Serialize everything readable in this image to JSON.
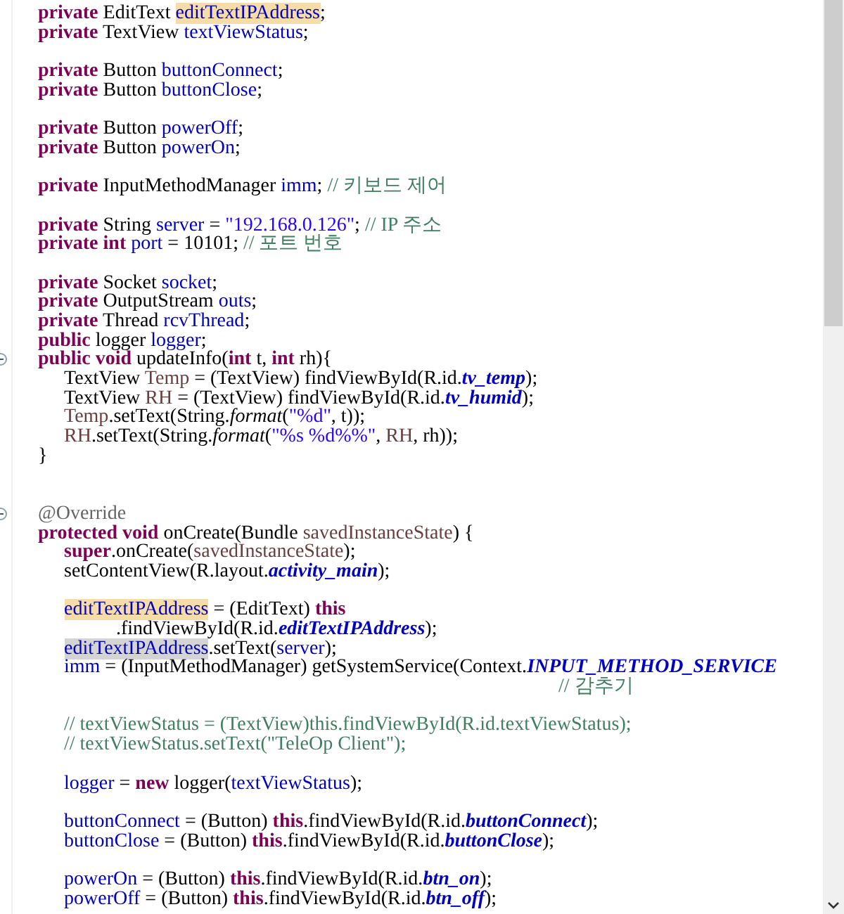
{
  "editor": {
    "lines": [
      {
        "kind": "code",
        "tokens": [
          {
            "text": "private",
            "kind": "keyword"
          },
          {
            "text": " EditText ",
            "kind": "plain"
          },
          {
            "text": "editTextIPAddress",
            "kind": "field",
            "occurrence": true
          },
          {
            "text": ";",
            "kind": "plain"
          }
        ]
      },
      {
        "kind": "code",
        "tokens": [
          {
            "text": "private",
            "kind": "keyword"
          },
          {
            "text": " TextView ",
            "kind": "plain"
          },
          {
            "text": "textViewStatus",
            "kind": "field"
          },
          {
            "text": ";",
            "kind": "plain"
          }
        ]
      },
      {
        "kind": "blank"
      },
      {
        "kind": "code",
        "tokens": [
          {
            "text": "private",
            "kind": "keyword"
          },
          {
            "text": " Button ",
            "kind": "plain"
          },
          {
            "text": "buttonConnect",
            "kind": "field"
          },
          {
            "text": ";",
            "kind": "plain"
          }
        ]
      },
      {
        "kind": "code",
        "tokens": [
          {
            "text": "private",
            "kind": "keyword"
          },
          {
            "text": " Button ",
            "kind": "plain"
          },
          {
            "text": "buttonClose",
            "kind": "field"
          },
          {
            "text": ";",
            "kind": "plain"
          }
        ]
      },
      {
        "kind": "blank"
      },
      {
        "kind": "code",
        "tokens": [
          {
            "text": "private",
            "kind": "keyword"
          },
          {
            "text": " Button ",
            "kind": "plain"
          },
          {
            "text": "powerOff",
            "kind": "field"
          },
          {
            "text": ";",
            "kind": "plain"
          }
        ]
      },
      {
        "kind": "code",
        "tokens": [
          {
            "text": "private",
            "kind": "keyword"
          },
          {
            "text": " Button ",
            "kind": "plain"
          },
          {
            "text": "powerOn",
            "kind": "field"
          },
          {
            "text": ";",
            "kind": "plain"
          }
        ]
      },
      {
        "kind": "blank"
      },
      {
        "kind": "code",
        "tokens": [
          {
            "text": "private",
            "kind": "keyword"
          },
          {
            "text": " InputMethodManager ",
            "kind": "plain"
          },
          {
            "text": "imm",
            "kind": "field"
          },
          {
            "text": "; ",
            "kind": "plain"
          },
          {
            "text": "// 키보드 제어",
            "kind": "comment"
          }
        ]
      },
      {
        "kind": "blank"
      },
      {
        "kind": "code",
        "tokens": [
          {
            "text": "private",
            "kind": "keyword"
          },
          {
            "text": " String ",
            "kind": "plain"
          },
          {
            "text": "server",
            "kind": "field"
          },
          {
            "text": " = ",
            "kind": "plain"
          },
          {
            "text": "\"192.168.0.126\"",
            "kind": "string"
          },
          {
            "text": "; ",
            "kind": "plain"
          },
          {
            "text": "// IP 주소",
            "kind": "comment"
          }
        ]
      },
      {
        "kind": "code",
        "tokens": [
          {
            "text": "private int ",
            "kind": "keyword"
          },
          {
            "text": "port",
            "kind": "field"
          },
          {
            "text": " = 10101; ",
            "kind": "plain"
          },
          {
            "text": "// 포트 번호",
            "kind": "comment"
          }
        ]
      },
      {
        "kind": "blank"
      },
      {
        "kind": "code",
        "tokens": [
          {
            "text": "private",
            "kind": "keyword"
          },
          {
            "text": " Socket ",
            "kind": "plain"
          },
          {
            "text": "socket",
            "kind": "field"
          },
          {
            "text": ";",
            "kind": "plain"
          }
        ]
      },
      {
        "kind": "code",
        "tokens": [
          {
            "text": "private",
            "kind": "keyword"
          },
          {
            "text": " OutputStream ",
            "kind": "plain"
          },
          {
            "text": "outs",
            "kind": "field"
          },
          {
            "text": ";",
            "kind": "plain"
          }
        ]
      },
      {
        "kind": "code",
        "tokens": [
          {
            "text": "private",
            "kind": "keyword"
          },
          {
            "text": " Thread ",
            "kind": "plain"
          },
          {
            "text": "rcvThread",
            "kind": "field"
          },
          {
            "text": ";",
            "kind": "plain"
          }
        ]
      },
      {
        "kind": "code",
        "tokens": [
          {
            "text": "public",
            "kind": "keyword"
          },
          {
            "text": " logger ",
            "kind": "plain"
          },
          {
            "text": "logger",
            "kind": "field"
          },
          {
            "text": ";",
            "kind": "plain"
          }
        ]
      },
      {
        "kind": "code",
        "expanded": true,
        "tokens": [
          {
            "text": "public void",
            "kind": "keyword"
          },
          {
            "text": " updateInfo(",
            "kind": "plain"
          },
          {
            "text": "int",
            "kind": "keyword"
          },
          {
            "text": " t, ",
            "kind": "plain"
          },
          {
            "text": "int",
            "kind": "keyword"
          },
          {
            "text": " rh){",
            "kind": "plain"
          }
        ]
      },
      {
        "kind": "code",
        "indented": true,
        "tokens": [
          {
            "text": "TextView ",
            "kind": "plain"
          },
          {
            "text": "Temp",
            "kind": "local"
          },
          {
            "text": " = (TextView) findViewById(R.id.",
            "kind": "plain"
          },
          {
            "text": "tv_temp",
            "kind": "constant"
          },
          {
            "text": ");",
            "kind": "plain"
          }
        ]
      },
      {
        "kind": "code",
        "indented": true,
        "tokens": [
          {
            "text": "TextView ",
            "kind": "plain"
          },
          {
            "text": "RH",
            "kind": "local"
          },
          {
            "text": " = (TextView) findViewById(R.id.",
            "kind": "plain"
          },
          {
            "text": "tv_humid",
            "kind": "constant"
          },
          {
            "text": ");",
            "kind": "plain"
          }
        ]
      },
      {
        "kind": "code",
        "indented": true,
        "tokens": [
          {
            "text": "Temp",
            "kind": "local"
          },
          {
            "text": ".setText(String.",
            "kind": "plain"
          },
          {
            "text": "format",
            "kind": "static"
          },
          {
            "text": "(",
            "kind": "plain"
          },
          {
            "text": "\"%d\"",
            "kind": "string"
          },
          {
            "text": ", t));",
            "kind": "plain"
          }
        ]
      },
      {
        "kind": "code",
        "indented": true,
        "tokens": [
          {
            "text": "RH",
            "kind": "local"
          },
          {
            "text": ".setText(String.",
            "kind": "plain"
          },
          {
            "text": "format",
            "kind": "static"
          },
          {
            "text": "(",
            "kind": "plain"
          },
          {
            "text": "\"%s %d%%\"",
            "kind": "string"
          },
          {
            "text": ", ",
            "kind": "plain"
          },
          {
            "text": "RH",
            "kind": "local"
          },
          {
            "text": ", rh));",
            "kind": "plain"
          }
        ]
      },
      {
        "kind": "code",
        "tokens": [
          {
            "text": "}",
            "kind": "plain"
          }
        ]
      },
      {
        "kind": "blank"
      },
      {
        "kind": "blank"
      },
      {
        "kind": "code",
        "expanded": true,
        "tokens": [
          {
            "text": "@Override",
            "kind": "annotation"
          }
        ]
      },
      {
        "kind": "code",
        "tokens": [
          {
            "text": "protected void",
            "kind": "keyword"
          },
          {
            "text": " onCreate(Bundle ",
            "kind": "plain"
          },
          {
            "text": "savedInstanceState",
            "kind": "local"
          },
          {
            "text": ") {",
            "kind": "plain"
          }
        ]
      },
      {
        "kind": "code",
        "indented": true,
        "tokens": [
          {
            "text": "super",
            "kind": "keyword"
          },
          {
            "text": ".onCreate(",
            "kind": "plain"
          },
          {
            "text": "savedInstanceState",
            "kind": "local"
          },
          {
            "text": ");",
            "kind": "plain"
          }
        ]
      },
      {
        "kind": "code",
        "indented": true,
        "tokens": [
          {
            "text": "setContentView(R.layout.",
            "kind": "plain"
          },
          {
            "text": "activity_main",
            "kind": "constant"
          },
          {
            "text": ");",
            "kind": "plain"
          }
        ]
      },
      {
        "kind": "blank"
      },
      {
        "kind": "code",
        "indented": true,
        "tokens": [
          {
            "text": "editTextIPAddress",
            "kind": "field",
            "occurrence": true
          },
          {
            "text": " = (EditText) ",
            "kind": "plain"
          },
          {
            "text": "this",
            "kind": "keyword"
          }
        ]
      },
      {
        "kind": "code",
        "tokens": [
          {
            "text": "\t\t\t.findViewById(R.id.",
            "kind": "plain"
          },
          {
            "text": "editTextIPAddress",
            "kind": "constant"
          },
          {
            "text": ");",
            "kind": "plain"
          }
        ]
      },
      {
        "kind": "code",
        "indented": true,
        "tokens": [
          {
            "text": "editTextIPAddress",
            "kind": "field",
            "selected": true
          },
          {
            "text": ".setText(",
            "kind": "plain"
          },
          {
            "text": "server",
            "kind": "field"
          },
          {
            "text": ");",
            "kind": "plain"
          }
        ]
      },
      {
        "kind": "code",
        "indented": true,
        "tokens": [
          {
            "text": "imm",
            "kind": "field"
          },
          {
            "text": " = (InputMethodManager) getSystemService(Context.",
            "kind": "plain"
          },
          {
            "text": "INPUT_METHOD_SERVICE",
            "kind": "constant"
          }
        ]
      },
      {
        "kind": "code",
        "tokens": [
          {
            "text": "\t\t\t\t\t\t\t\t\t\t\t\t\t\t\t\t\t\t\t\t// 감추기",
            "kind": "comment"
          }
        ]
      },
      {
        "kind": "blank"
      },
      {
        "kind": "code",
        "indented": true,
        "tokens": [
          {
            "text": "// textViewStatus = (TextView)this.findViewById(R.id.textViewStatus);",
            "kind": "comment"
          }
        ]
      },
      {
        "kind": "code",
        "indented": true,
        "tokens": [
          {
            "text": "// textViewStatus.setText(\"TeleOp Client\");",
            "kind": "comment"
          }
        ]
      },
      {
        "kind": "blank"
      },
      {
        "kind": "code",
        "indented": true,
        "tokens": [
          {
            "text": "logger",
            "kind": "field"
          },
          {
            "text": " = ",
            "kind": "plain"
          },
          {
            "text": "new",
            "kind": "keyword"
          },
          {
            "text": " logger(",
            "kind": "plain"
          },
          {
            "text": "textViewStatus",
            "kind": "field"
          },
          {
            "text": ");",
            "kind": "plain"
          }
        ]
      },
      {
        "kind": "blank"
      },
      {
        "kind": "code",
        "indented": true,
        "tokens": [
          {
            "text": "buttonConnect",
            "kind": "field"
          },
          {
            "text": " = (Button) ",
            "kind": "plain"
          },
          {
            "text": "this",
            "kind": "keyword"
          },
          {
            "text": ".findViewById(R.id.",
            "kind": "plain"
          },
          {
            "text": "buttonConnect",
            "kind": "constant"
          },
          {
            "text": ");",
            "kind": "plain"
          }
        ]
      },
      {
        "kind": "code",
        "indented": true,
        "tokens": [
          {
            "text": "buttonClose",
            "kind": "field"
          },
          {
            "text": " = (Button) ",
            "kind": "plain"
          },
          {
            "text": "this",
            "kind": "keyword"
          },
          {
            "text": ".findViewById(R.id.",
            "kind": "plain"
          },
          {
            "text": "buttonClose",
            "kind": "constant"
          },
          {
            "text": ");",
            "kind": "plain"
          }
        ]
      },
      {
        "kind": "blank"
      },
      {
        "kind": "code",
        "indented": true,
        "tokens": [
          {
            "text": "powerOn",
            "kind": "field"
          },
          {
            "text": " = (Button) ",
            "kind": "plain"
          },
          {
            "text": "this",
            "kind": "keyword"
          },
          {
            "text": ".findViewById(R.id.",
            "kind": "plain"
          },
          {
            "text": "btn_on",
            "kind": "constant"
          },
          {
            "text": ");",
            "kind": "plain"
          }
        ]
      },
      {
        "kind": "code",
        "indented": true,
        "tokens": [
          {
            "text": "powerOff",
            "kind": "field"
          },
          {
            "text": " = (Button) ",
            "kind": "plain"
          },
          {
            "text": "this",
            "kind": "keyword"
          },
          {
            "text": ".findViewById(R.id.",
            "kind": "plain"
          },
          {
            "text": "btn_off",
            "kind": "constant"
          },
          {
            "text": ");",
            "kind": "plain"
          }
        ]
      }
    ]
  }
}
